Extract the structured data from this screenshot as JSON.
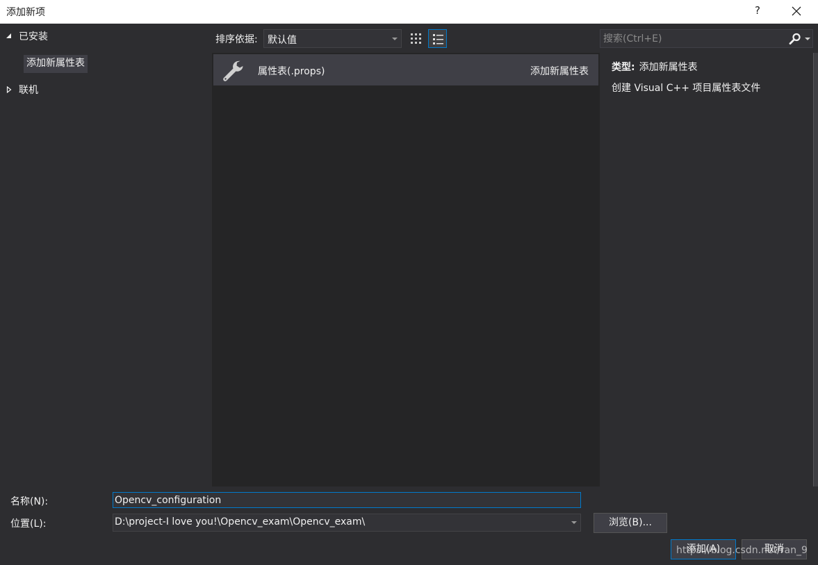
{
  "window": {
    "title": "添加新项",
    "help_label": "?"
  },
  "tree": {
    "installed_label": "已安装",
    "selected_item": "添加新属性表",
    "online_label": "联机"
  },
  "toolbar": {
    "sort_label": "排序依据:",
    "sort_value": "默认值"
  },
  "templates": [
    {
      "name": "属性表(.props)",
      "category": "添加新属性表",
      "icon": "wrench-icon"
    }
  ],
  "search": {
    "placeholder": "搜索(Ctrl+E)"
  },
  "info": {
    "type_label": "类型:",
    "type_value": "添加新属性表",
    "description": "创建 Visual C++ 项目属性表文件"
  },
  "form": {
    "name_label": "名称(N):",
    "name_value": "Opencv_configuration",
    "location_label": "位置(L):",
    "location_value": "D:\\project-I love you!\\Opencv_exam\\Opencv_exam\\",
    "browse_label": "浏览(B)...",
    "add_label": "添加(A)",
    "cancel_label": "取消"
  },
  "watermark": "https://blog.csdn.net/ran_9",
  "colors": {
    "accent": "#007acc",
    "background": "#2d2d30",
    "pane": "#252526",
    "selected": "#3f3f46"
  }
}
